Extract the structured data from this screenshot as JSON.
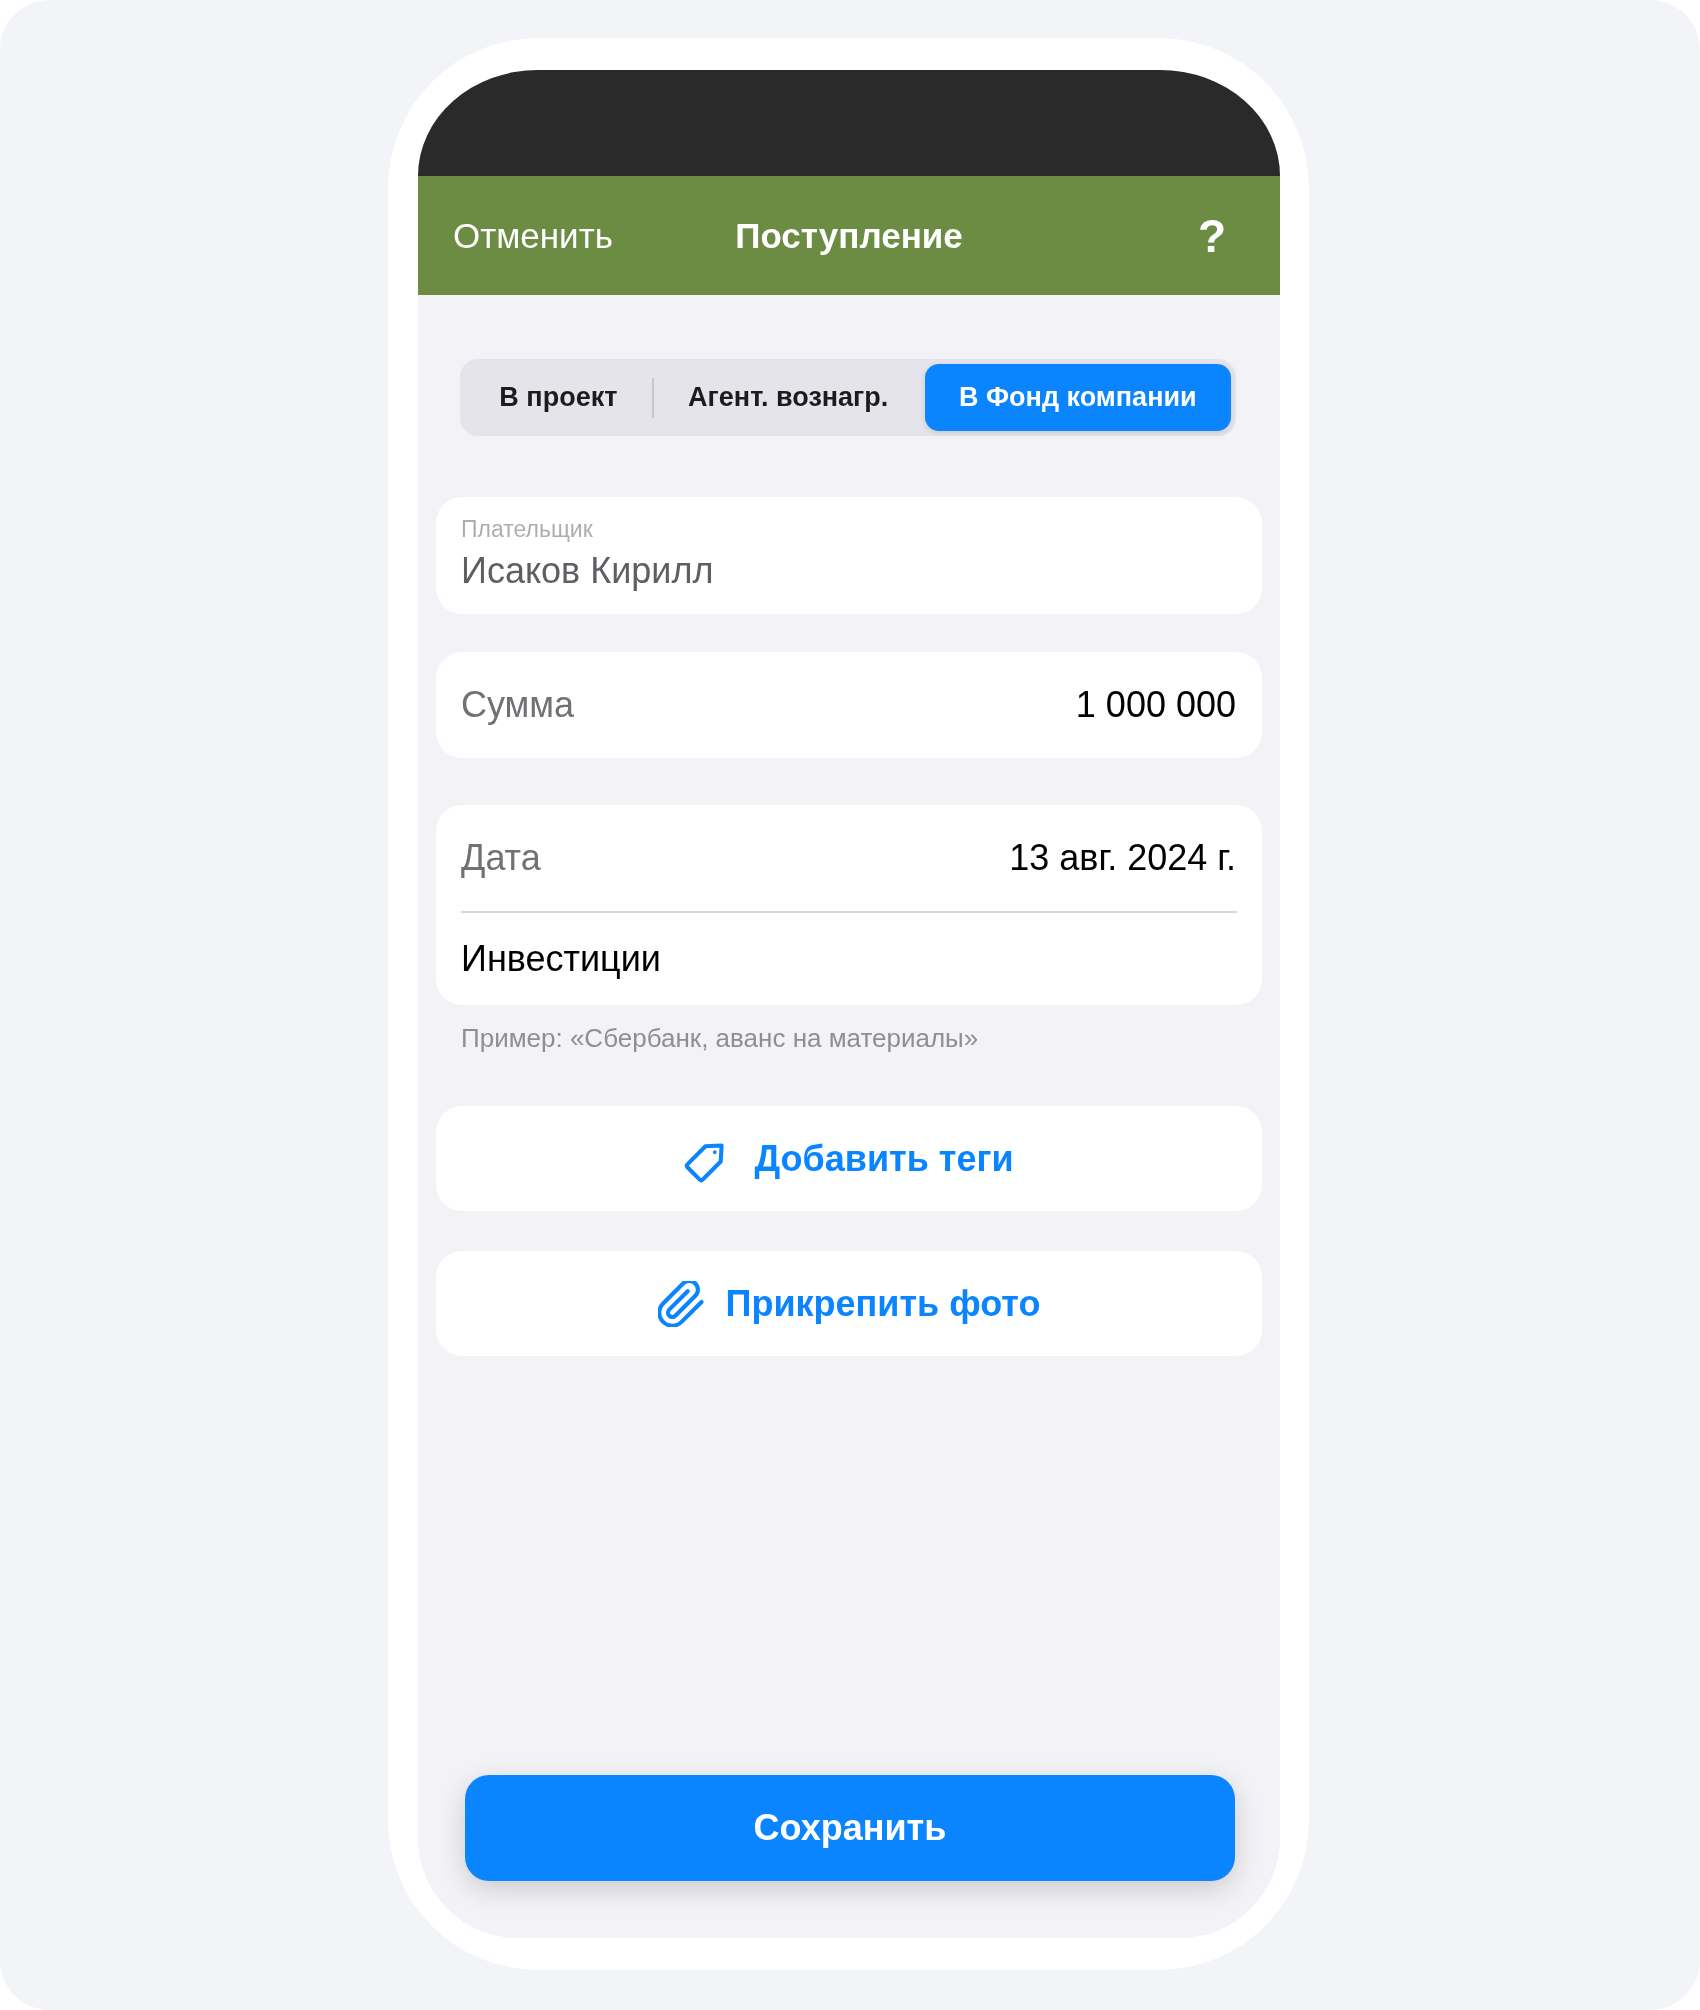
{
  "header": {
    "cancel": "Отменить",
    "title": "Поступление",
    "help": "?"
  },
  "segments": [
    {
      "label": "В проект",
      "selected": false
    },
    {
      "label": "Агент. вознагр.",
      "selected": false
    },
    {
      "label": "В Фонд компании",
      "selected": true
    }
  ],
  "form": {
    "payer": {
      "label": "Плательщик",
      "value": "Исаков Кирилл"
    },
    "amount": {
      "label": "Сумма",
      "value": "1 000 000"
    },
    "date": {
      "label": "Дата",
      "value": "13 авг. 2024 г."
    },
    "purpose": {
      "value": "Инвестиции"
    },
    "hint": "Пример: «Сбербанк, аванс на материалы»"
  },
  "actions": [
    {
      "kind": "tag",
      "label": "Добавить теги"
    },
    {
      "kind": "attach",
      "label": "Прикрепить фото"
    }
  ],
  "save_button": "Сохранить"
}
